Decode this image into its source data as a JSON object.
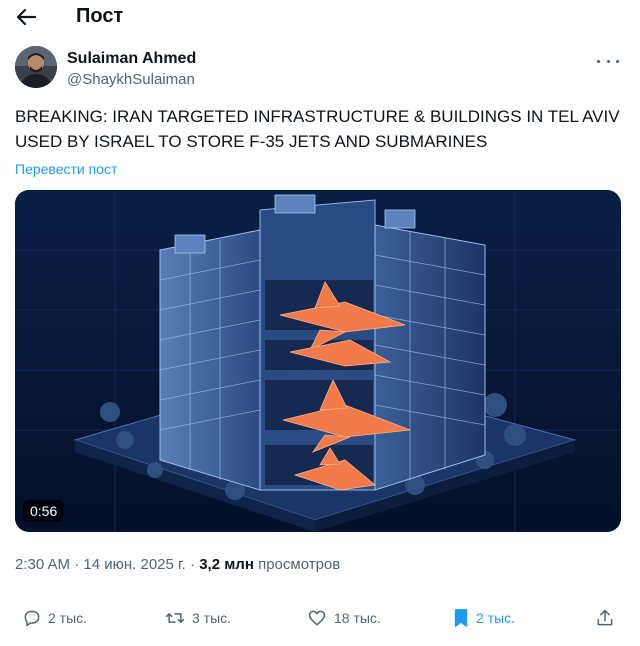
{
  "header": {
    "title": "Пост"
  },
  "author": {
    "name": "Sulaiman Ahmed",
    "handle": "@ShaykhSulaiman"
  },
  "tweet": {
    "text": "BREAKING: IRAN TARGETED INFRASTRUCTURE & BUILDINGS IN TEL AVIV USED BY ISRAEL TO STORE F-35 JETS AND SUBMARINES",
    "translate_label": "Перевести пост"
  },
  "media": {
    "duration": "0:56"
  },
  "meta": {
    "time": "2:30 AM",
    "date": "14 июн. 2025 г.",
    "separator": "·",
    "views_count": "3,2 млн",
    "views_label": "просмотров"
  },
  "actions": {
    "replies": "2 тыс.",
    "reposts": "3 тыс.",
    "likes": "18 тыс.",
    "bookmarks": "2 тыс."
  },
  "colors": {
    "accent": "#1d9bf0",
    "secondary_text": "#536471",
    "primary_text": "#0f1419"
  }
}
